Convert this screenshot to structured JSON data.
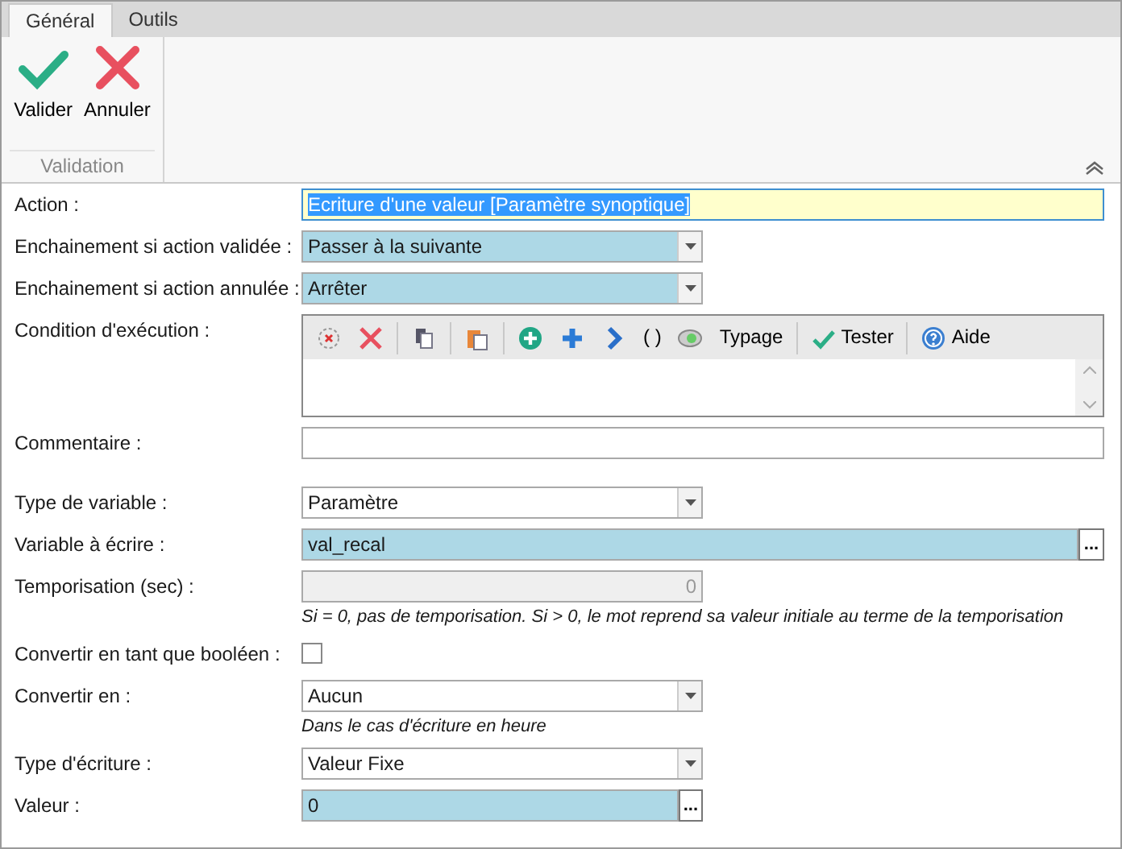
{
  "tabs": [
    {
      "label": "Général",
      "selected": true
    },
    {
      "label": "Outils",
      "selected": false
    }
  ],
  "ribbon": {
    "buttons": [
      {
        "label": "Valider",
        "kind": "ok"
      },
      {
        "label": "Annuler",
        "kind": "cancel"
      }
    ],
    "group_label": "Validation"
  },
  "sections": [
    [
      {
        "label": "Action :",
        "kind": "text",
        "value": "Ecriture d'une valeur [Paramètre synoptique]",
        "focused": true
      },
      {
        "label": "Enchainement si action validée :",
        "kind": "combo",
        "value": "Passer à la suivante",
        "highlighted": true
      },
      {
        "label": "Enchainement si action annulée :",
        "kind": "combo",
        "value": "Arrêter",
        "highlighted": true
      },
      {
        "label": "Condition d'exécution :",
        "kind": "expression",
        "toolbar": [
          "( )",
          "Typage",
          "Tester",
          "Aide"
        ]
      },
      {
        "label": "Commentaire :",
        "kind": "text",
        "focused": false
      }
    ],
    [
      {
        "label": "Type de variable :",
        "kind": "combo",
        "value": "Paramètre",
        "highlighted": false
      },
      {
        "label": "Variable à écrire :",
        "kind": "browse",
        "value": "val_recal",
        "highlighted": true,
        "button": "..."
      },
      {
        "label": "Temporisation (sec) :",
        "kind": "number",
        "value": "0",
        "disabled": true,
        "note": "Si = 0, pas de temporisation. Si > 0, le mot reprend sa valeur initiale au terme de la temporisation"
      },
      {
        "label": "Convertir en tant que booléen :",
        "kind": "checkbox",
        "checked": false
      },
      {
        "label": "Convertir en :",
        "kind": "combo",
        "value": "Aucun",
        "highlighted": false,
        "note": "Dans le cas d'écriture en heure"
      },
      {
        "label": "Type d'écriture :",
        "kind": "combo",
        "value": "Valeur Fixe",
        "highlighted": false
      },
      {
        "label": "Valeur :",
        "kind": "browse",
        "value": "0",
        "highlighted": true,
        "button": "..."
      }
    ]
  ]
}
